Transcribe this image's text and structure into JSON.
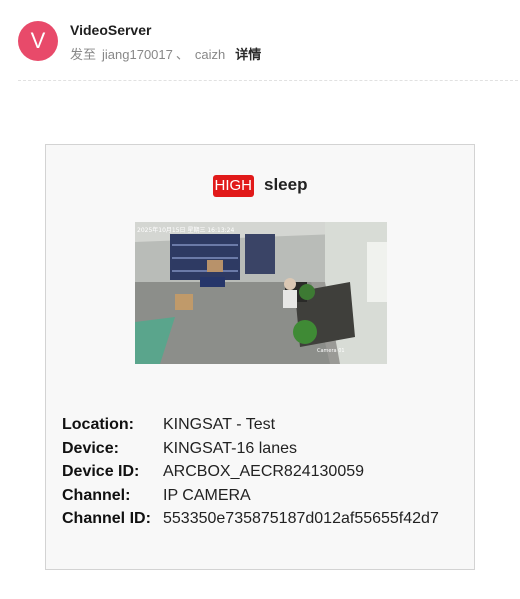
{
  "email": {
    "avatar_letter": "V",
    "sender": "VideoServer",
    "to_label": "发至",
    "recipients": [
      "jiang170017",
      "caizh"
    ],
    "separator": "、",
    "details_link": "详情"
  },
  "alert": {
    "level": "HIGH",
    "event": "sleep",
    "snapshot_timestamp": "2025年10月15日 星期三 16:13:24",
    "snapshot_watermark": "Camera 01",
    "fields": [
      {
        "label": "Location:",
        "value": "KINGSAT - Test"
      },
      {
        "label": "Device:",
        "value": "KINGSAT-16 lanes"
      },
      {
        "label": "Device ID:",
        "value": "ARCBOX_AECR824130059"
      },
      {
        "label": "Channel:",
        "value": "IP CAMERA"
      },
      {
        "label": "Channel ID:",
        "value": "553350e735875187d012af55655f42d7"
      }
    ]
  },
  "colors": {
    "avatar": "#e84a6a",
    "badge": "#e11a1a",
    "card_bg": "#f8f8f8",
    "card_border": "#d3d3d3"
  }
}
